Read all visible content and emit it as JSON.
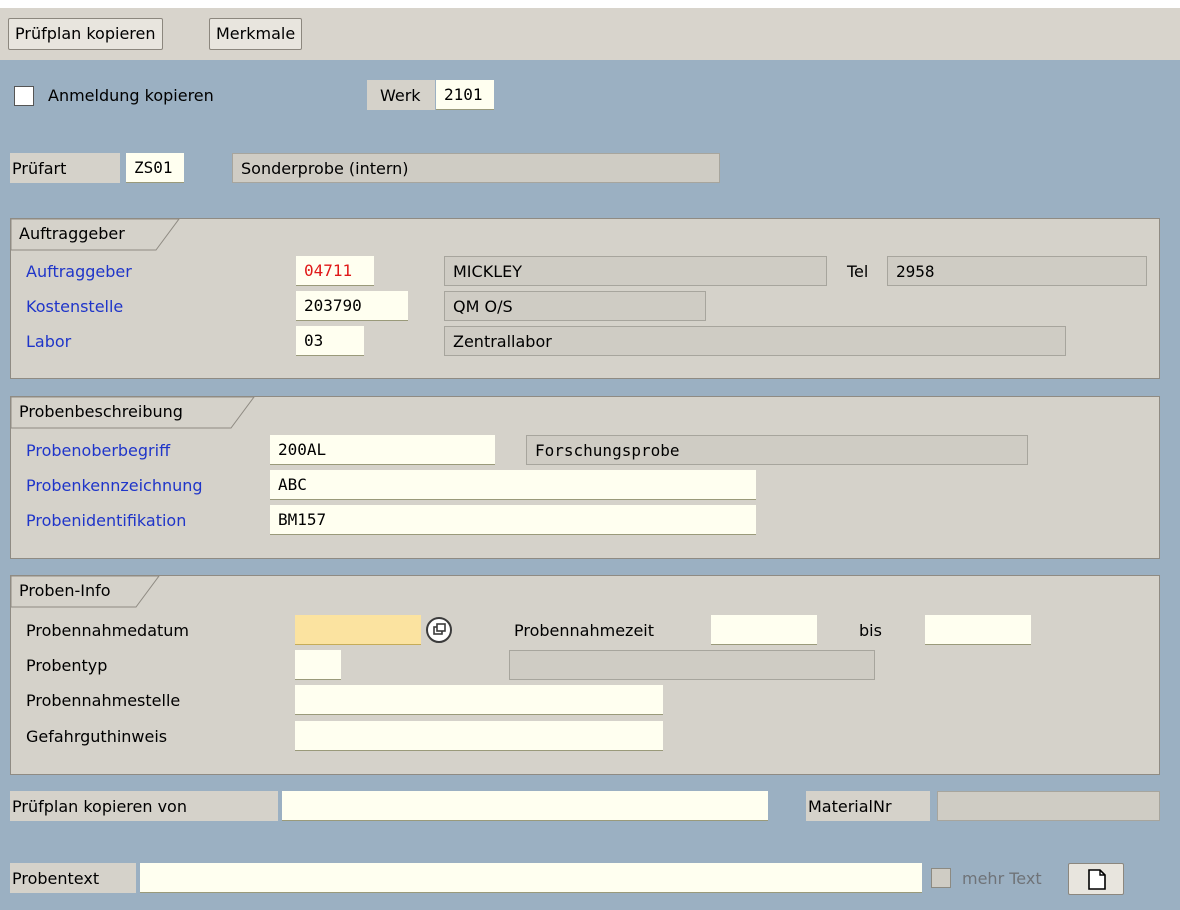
{
  "toolbar": {
    "pruefplan_kopieren_label": "Prüfplan kopieren",
    "merkmale_label": "Merkmale"
  },
  "header": {
    "anmeldung_label": "Anmeldung kopieren",
    "anmeldung_checked": false,
    "werk_label": "Werk",
    "werk_value": "2101",
    "pruefart_label": "Prüfart",
    "pruefart_value": "ZS01",
    "pruefart_text": "Sonderprobe (intern)"
  },
  "auftraggeber": {
    "title": "Auftraggeber",
    "auftraggeber_label": "Auftraggeber",
    "auftraggeber_value": "04711",
    "auftraggeber_name": "MICKLEY",
    "tel_label": "Tel",
    "tel_value": "2958",
    "kostenstelle_label": "Kostenstelle",
    "kostenstelle_value": "203790",
    "kostenstelle_text": "QM O/S",
    "labor_label": "Labor",
    "labor_value": "03",
    "labor_text": "Zentrallabor"
  },
  "probenbeschreibung": {
    "title": "Probenbeschreibung",
    "oberbegriff_label": "Probenoberbegriff",
    "oberbegriff_value": "200AL",
    "oberbegriff_text": "Forschungsprobe",
    "kennzeichnung_label": "Probenkennzeichnung",
    "kennzeichnung_value": "ABC",
    "identifikation_label": "Probenidentifikation",
    "identifikation_value": "BM157"
  },
  "probeninfo": {
    "title": "Proben-Info",
    "datum_label": "Probennahmedatum",
    "datum_value": "",
    "zeit_label": "Probennahmezeit",
    "zeit_value": "",
    "bis_label": "bis",
    "bis_value": "",
    "typ_label": "Probentyp",
    "typ_value": "",
    "typ_text": "",
    "stelle_label": "Probennahmestelle",
    "stelle_value": "",
    "gefahrgut_label": "Gefahrguthinweis",
    "gefahrgut_value": ""
  },
  "footer": {
    "kopieren_von_label": "Prüfplan kopieren von",
    "kopieren_von_value": "",
    "materialnr_label": "MaterialNr",
    "materialnr_value": "",
    "probentext_label": "Probentext",
    "probentext_value": "",
    "mehr_text_label": "mehr Text",
    "mehr_text_checked": false
  },
  "icons": {
    "calendar_help": "value-help-icon",
    "new_document": "new-document-icon"
  }
}
